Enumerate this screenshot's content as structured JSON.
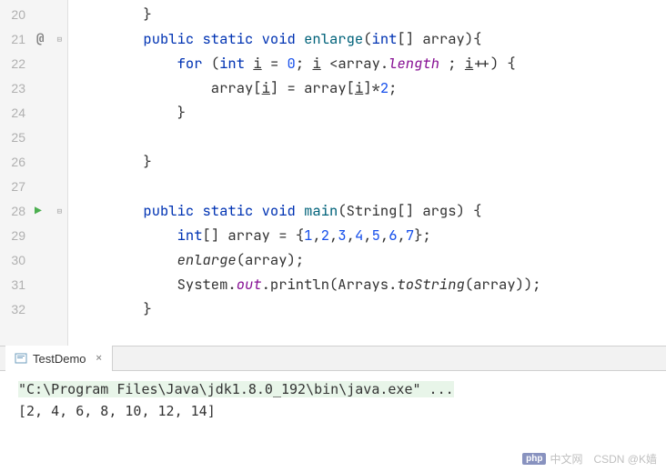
{
  "gutter": {
    "lines": [
      "20",
      "21",
      "22",
      "23",
      "24",
      "25",
      "26",
      "27",
      "28",
      "29",
      "30",
      "31",
      "32"
    ],
    "annotation": "@",
    "run_glyph": "▶"
  },
  "code": {
    "l20": "        }",
    "l21_pre": "        ",
    "l21_kw1": "public static void ",
    "l21_method": "enlarge",
    "l21_post1": "(",
    "l21_kw2": "int",
    "l21_post2": "[] array){",
    "l22_pre": "            ",
    "l22_kw1": "for ",
    "l22_post1": "(",
    "l22_kw2": "int ",
    "l22_var1": "i",
    "l22_post2": " = ",
    "l22_num1": "0",
    "l22_post3": "; ",
    "l22_var2": "i",
    "l22_post4": " <array.",
    "l22_field": "length",
    "l22_post5": " ; ",
    "l22_var3": "i",
    "l22_post6": "++) {",
    "l23_pre": "                array[",
    "l23_var1": "i",
    "l23_post1": "] = array[",
    "l23_var2": "i",
    "l23_post2": "]*",
    "l23_num": "2",
    "l23_post3": ";",
    "l24": "            }",
    "l25": "",
    "l26": "        }",
    "l27": "",
    "l28_pre": "        ",
    "l28_kw1": "public static void ",
    "l28_method": "main",
    "l28_post1": "(String[] args) {",
    "l29_pre": "            ",
    "l29_kw1": "int",
    "l29_post1": "[] array = {",
    "l29_n1": "1",
    "l29_c1": ",",
    "l29_n2": "2",
    "l29_c2": ",",
    "l29_n3": "3",
    "l29_c3": ",",
    "l29_n4": "4",
    "l29_c4": ",",
    "l29_n5": "5",
    "l29_c5": ",",
    "l29_n6": "6",
    "l29_c6": ",",
    "l29_n7": "7",
    "l29_post2": "};",
    "l30_pre": "            ",
    "l30_call": "enlarge",
    "l30_post": "(array);",
    "l31_pre": "            System.",
    "l31_out": "out",
    "l31_post1": ".println(Arrays.",
    "l31_ts": "toString",
    "l31_post2": "(array));",
    "l32": "        }"
  },
  "console": {
    "tab_label": "TestDemo",
    "cmd": "\"C:\\Program Files\\Java\\jdk1.8.0_192\\bin\\java.exe\" ...",
    "output": "[2, 4, 6, 8, 10, 12, 14]"
  },
  "watermark": {
    "php": "php",
    "text1": "中文网",
    "text2": "CSDN @K嫱"
  }
}
